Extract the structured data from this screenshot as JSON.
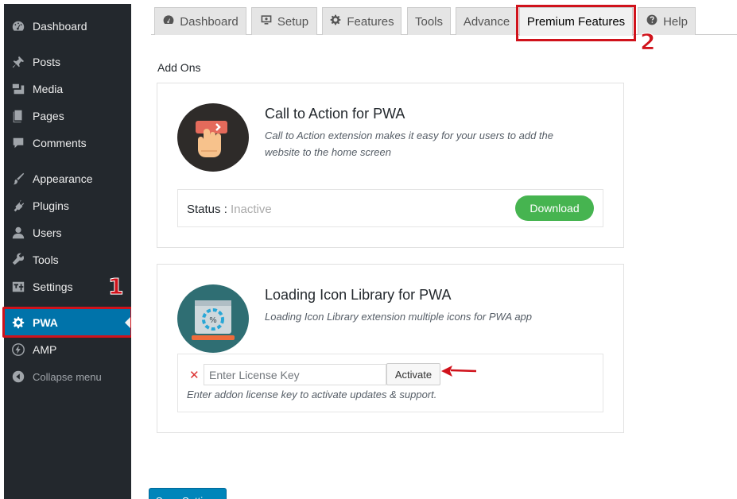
{
  "sidebar": {
    "items": [
      {
        "label": "Dashboard",
        "icon": "dashboard-icon"
      },
      {
        "label": "Posts",
        "icon": "pin-icon"
      },
      {
        "label": "Media",
        "icon": "media-icon"
      },
      {
        "label": "Pages",
        "icon": "pages-icon"
      },
      {
        "label": "Comments",
        "icon": "comment-icon"
      },
      {
        "label": "Appearance",
        "icon": "brush-icon"
      },
      {
        "label": "Plugins",
        "icon": "plug-icon"
      },
      {
        "label": "Users",
        "icon": "user-icon"
      },
      {
        "label": "Tools",
        "icon": "wrench-icon"
      },
      {
        "label": "Settings",
        "icon": "settings-icon"
      },
      {
        "label": "PWA",
        "icon": "gear-icon",
        "active": true
      },
      {
        "label": "AMP",
        "icon": "bolt-icon"
      },
      {
        "label": "Collapse menu",
        "icon": "collapse-icon"
      }
    ]
  },
  "annotations": {
    "marker_1": "1",
    "marker_2": "2",
    "color": "#d0121b"
  },
  "tabs": [
    {
      "label": "Dashboard",
      "icon": "dashboard-icon"
    },
    {
      "label": "Setup",
      "icon": "monitor-icon"
    },
    {
      "label": "Features",
      "icon": "gear-icon"
    },
    {
      "label": "Tools"
    },
    {
      "label": "Advance"
    },
    {
      "label": "Premium Features",
      "active": true
    },
    {
      "label": "Help",
      "icon": "help-icon"
    }
  ],
  "main": {
    "section_title": "Add Ons",
    "addons": [
      {
        "title": "Call to Action for PWA",
        "description": "Call to Action extension makes it easy for your users to add the website to the home screen",
        "status_label": "Status :",
        "status_value": "Inactive",
        "button_label": "Download"
      },
      {
        "title": "Loading Icon Library for PWA",
        "description": "Loading Icon Library extension multiple icons for PWA app",
        "license_placeholder": "Enter License Key",
        "button_label": "Activate",
        "help_text": "Enter addon license key to activate updates & support."
      }
    ],
    "save_label": "Save Settings"
  },
  "colors": {
    "sidebar_bg": "#23282d",
    "active_bg": "#0073aa",
    "download_green": "#46b450",
    "save_blue": "#0085ba"
  }
}
